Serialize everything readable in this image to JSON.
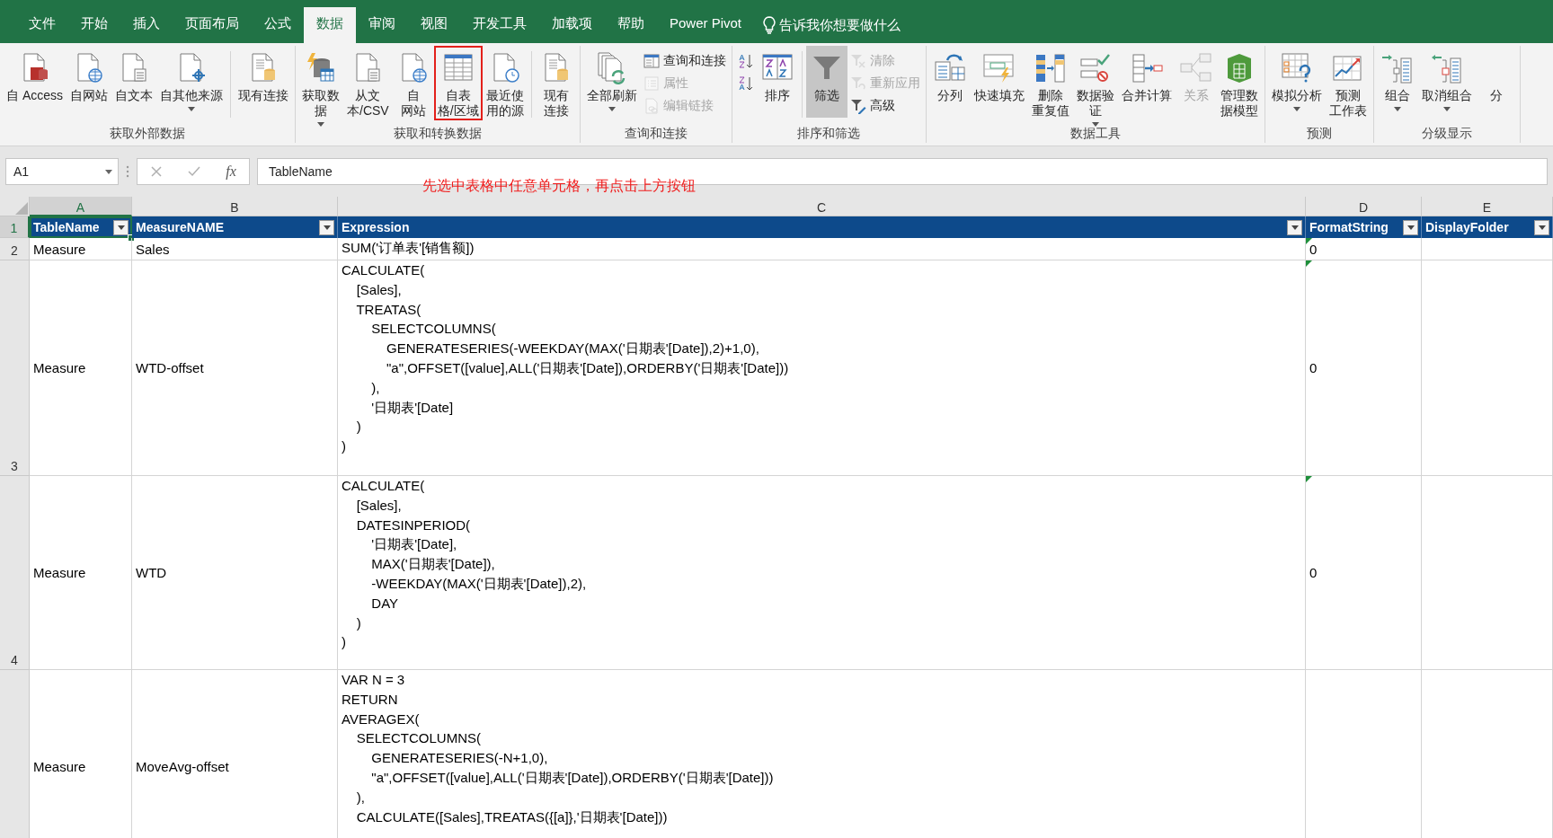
{
  "tabs": [
    {
      "label": "文件",
      "selected": false
    },
    {
      "label": "开始",
      "selected": false
    },
    {
      "label": "插入",
      "selected": false
    },
    {
      "label": "页面布局",
      "selected": false
    },
    {
      "label": "公式",
      "selected": false
    },
    {
      "label": "数据",
      "selected": true
    },
    {
      "label": "审阅",
      "selected": false
    },
    {
      "label": "视图",
      "selected": false
    },
    {
      "label": "开发工具",
      "selected": false
    },
    {
      "label": "加载项",
      "selected": false
    },
    {
      "label": "帮助",
      "selected": false
    },
    {
      "label": "Power Pivot",
      "selected": false
    }
  ],
  "tell_me": "告诉我你想要做什么",
  "ribbon_groups": [
    {
      "label": "获取外部数据",
      "items": [
        {
          "kind": "large",
          "lines": [
            "自 Access"
          ],
          "dropdown": false
        },
        {
          "kind": "large",
          "lines": [
            "自网站"
          ],
          "dropdown": false
        },
        {
          "kind": "large",
          "lines": [
            "自文本"
          ],
          "dropdown": false
        },
        {
          "kind": "large",
          "lines": [
            "自其他来源"
          ],
          "dropdown": true
        },
        {
          "kind": "separator"
        },
        {
          "kind": "large",
          "lines": [
            "现有连接"
          ],
          "dropdown": false
        }
      ]
    },
    {
      "label": "获取和转换数据",
      "items": [
        {
          "kind": "large",
          "lines": [
            "获取数",
            "据"
          ],
          "dropdown": true
        },
        {
          "kind": "large",
          "lines": [
            "从文",
            "本/CSV"
          ],
          "dropdown": false
        },
        {
          "kind": "large",
          "lines": [
            "自",
            "网站"
          ],
          "dropdown": false
        },
        {
          "kind": "large",
          "lines": [
            "自表",
            "格/区域"
          ],
          "dropdown": false,
          "highlighted": true
        },
        {
          "kind": "large",
          "lines": [
            "最近使",
            "用的源"
          ],
          "dropdown": false
        },
        {
          "kind": "separator"
        },
        {
          "kind": "large",
          "lines": [
            "现有",
            "连接"
          ],
          "dropdown": false
        }
      ]
    },
    {
      "label": "查询和连接",
      "items": [
        {
          "kind": "large",
          "lines": [
            "全部刷新"
          ],
          "dropdown": true
        },
        {
          "kind": "stack",
          "items": [
            {
              "label": "查询和连接",
              "disabled": false
            },
            {
              "label": "属性",
              "disabled": true
            },
            {
              "label": "编辑链接",
              "disabled": true
            }
          ]
        }
      ]
    },
    {
      "label": "排序和筛选",
      "items": [
        {
          "kind": "stack",
          "items": [
            {
              "disabled": false
            },
            {
              "disabled": false
            }
          ]
        },
        {
          "kind": "large",
          "lines": [
            "排序"
          ],
          "dropdown": false
        },
        {
          "kind": "separator"
        },
        {
          "kind": "large",
          "lines": [
            "筛选"
          ],
          "dropdown": false,
          "pressed": true
        },
        {
          "kind": "stack",
          "items": [
            {
              "label": "清除",
              "disabled": true
            },
            {
              "label": "重新应用",
              "disabled": true
            },
            {
              "label": "高级",
              "disabled": false
            }
          ]
        }
      ]
    },
    {
      "label": "数据工具",
      "items": [
        {
          "kind": "large",
          "lines": [
            "分列"
          ],
          "dropdown": false
        },
        {
          "kind": "large",
          "lines": [
            "快速填充"
          ],
          "dropdown": false
        },
        {
          "kind": "large",
          "lines": [
            "删除",
            "重复值"
          ],
          "dropdown": false
        },
        {
          "kind": "large",
          "lines": [
            "数据验",
            "证"
          ],
          "dropdown": true
        },
        {
          "kind": "large",
          "lines": [
            "合并计算"
          ],
          "dropdown": false
        },
        {
          "kind": "large",
          "lines": [
            "关系"
          ],
          "dropdown": false,
          "disabled": true
        },
        {
          "kind": "large",
          "lines": [
            "管理数",
            "据模型"
          ],
          "dropdown": false
        }
      ]
    },
    {
      "label": "预测",
      "items": [
        {
          "kind": "large",
          "lines": [
            "模拟分析"
          ],
          "dropdown": true
        },
        {
          "kind": "large",
          "lines": [
            "预测",
            "工作表"
          ],
          "dropdown": false
        }
      ]
    },
    {
      "label": "分级显示",
      "items": [
        {
          "kind": "large",
          "lines": [
            "组合"
          ],
          "dropdown": true
        },
        {
          "kind": "large",
          "lines": [
            "取消组合"
          ],
          "dropdown": true
        },
        {
          "kind": "large",
          "lines": [
            "分"
          ],
          "dropdown": false
        }
      ]
    }
  ],
  "formula_bar": {
    "name_box": "A1",
    "function_label": "fx",
    "value": "TableName"
  },
  "annotation": "先选中表格中任意单元格，再点击上方按钮",
  "columns": [
    {
      "label": "A",
      "selected": true
    },
    {
      "label": "B",
      "selected": false
    },
    {
      "label": "C",
      "selected": false
    },
    {
      "label": "D",
      "selected": false
    },
    {
      "label": "E",
      "selected": false
    }
  ],
  "table_header": {
    "row_number": "1",
    "row_selected": true,
    "cells": [
      "TableName",
      "MeasureNAME",
      "Expression",
      "FormatString",
      "DisplayFolder"
    ]
  },
  "rows": [
    {
      "row_number": "2",
      "table_name": "Measure",
      "measure_name": "Sales",
      "expression": "SUM('订单表'[销售额])",
      "format_string": "0",
      "warning": true
    },
    {
      "row_number": "3",
      "table_name": "Measure",
      "measure_name": "WTD-offset",
      "expression": "CALCULATE(\n    [Sales],\n    TREATAS(\n        SELECTCOLUMNS(\n            GENERATESERIES(-WEEKDAY(MAX('日期表'[Date]),2)+1,0),\n            \"a\",OFFSET([value],ALL('日期表'[Date]),ORDERBY('日期表'[Date]))\n        ),\n        '日期表'[Date]\n    )\n)",
      "format_string": "0",
      "warning": true
    },
    {
      "row_number": "4",
      "table_name": "Measure",
      "measure_name": "WTD",
      "expression": "CALCULATE(\n    [Sales],\n    DATESINPERIOD(\n        '日期表'[Date],\n        MAX('日期表'[Date]),\n        -WEEKDAY(MAX('日期表'[Date]),2),\n        DAY\n    )\n)",
      "format_string": "0",
      "warning": true
    },
    {
      "table_name": "Measure",
      "measure_name": "MoveAvg-offset",
      "expression": "VAR N = 3\nRETURN\nAVERAGEX(\n    SELECTCOLUMNS(\n        GENERATESERIES(-N+1,0),\n        \"a\",OFFSET([value],ALL('日期表'[Date]),ORDERBY('日期表'[Date]))\n    ),\n    CALCULATE([Sales],TREATAS({[a]},'日期表'[Date]))",
      "warning": false
    }
  ]
}
